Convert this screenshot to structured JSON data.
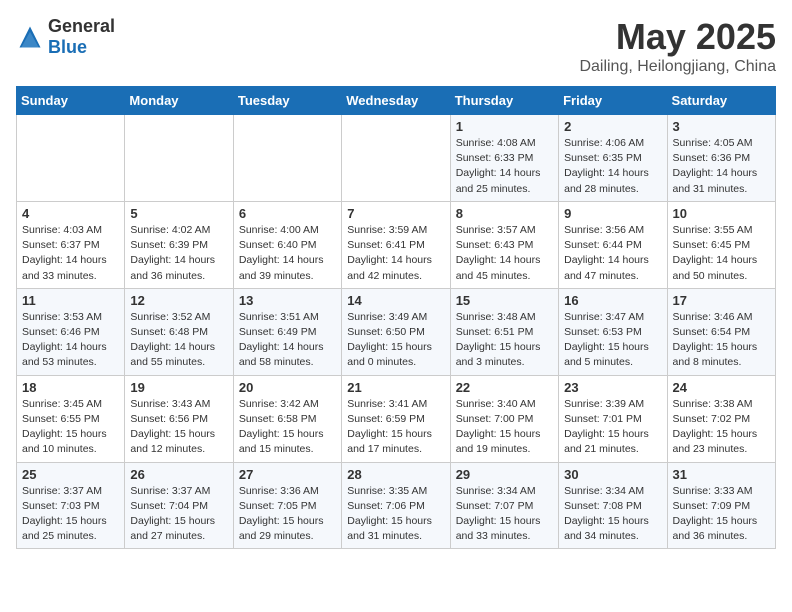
{
  "logo": {
    "general": "General",
    "blue": "Blue"
  },
  "title": "May 2025",
  "subtitle": "Dailing, Heilongjiang, China",
  "days_header": [
    "Sunday",
    "Monday",
    "Tuesday",
    "Wednesday",
    "Thursday",
    "Friday",
    "Saturday"
  ],
  "weeks": [
    [
      {
        "day": "",
        "info": ""
      },
      {
        "day": "",
        "info": ""
      },
      {
        "day": "",
        "info": ""
      },
      {
        "day": "",
        "info": ""
      },
      {
        "day": "1",
        "sunrise": "Sunrise: 4:08 AM",
        "sunset": "Sunset: 6:33 PM",
        "daylight": "Daylight: 14 hours and 25 minutes."
      },
      {
        "day": "2",
        "sunrise": "Sunrise: 4:06 AM",
        "sunset": "Sunset: 6:35 PM",
        "daylight": "Daylight: 14 hours and 28 minutes."
      },
      {
        "day": "3",
        "sunrise": "Sunrise: 4:05 AM",
        "sunset": "Sunset: 6:36 PM",
        "daylight": "Daylight: 14 hours and 31 minutes."
      }
    ],
    [
      {
        "day": "4",
        "sunrise": "Sunrise: 4:03 AM",
        "sunset": "Sunset: 6:37 PM",
        "daylight": "Daylight: 14 hours and 33 minutes."
      },
      {
        "day": "5",
        "sunrise": "Sunrise: 4:02 AM",
        "sunset": "Sunset: 6:39 PM",
        "daylight": "Daylight: 14 hours and 36 minutes."
      },
      {
        "day": "6",
        "sunrise": "Sunrise: 4:00 AM",
        "sunset": "Sunset: 6:40 PM",
        "daylight": "Daylight: 14 hours and 39 minutes."
      },
      {
        "day": "7",
        "sunrise": "Sunrise: 3:59 AM",
        "sunset": "Sunset: 6:41 PM",
        "daylight": "Daylight: 14 hours and 42 minutes."
      },
      {
        "day": "8",
        "sunrise": "Sunrise: 3:57 AM",
        "sunset": "Sunset: 6:43 PM",
        "daylight": "Daylight: 14 hours and 45 minutes."
      },
      {
        "day": "9",
        "sunrise": "Sunrise: 3:56 AM",
        "sunset": "Sunset: 6:44 PM",
        "daylight": "Daylight: 14 hours and 47 minutes."
      },
      {
        "day": "10",
        "sunrise": "Sunrise: 3:55 AM",
        "sunset": "Sunset: 6:45 PM",
        "daylight": "Daylight: 14 hours and 50 minutes."
      }
    ],
    [
      {
        "day": "11",
        "sunrise": "Sunrise: 3:53 AM",
        "sunset": "Sunset: 6:46 PM",
        "daylight": "Daylight: 14 hours and 53 minutes."
      },
      {
        "day": "12",
        "sunrise": "Sunrise: 3:52 AM",
        "sunset": "Sunset: 6:48 PM",
        "daylight": "Daylight: 14 hours and 55 minutes."
      },
      {
        "day": "13",
        "sunrise": "Sunrise: 3:51 AM",
        "sunset": "Sunset: 6:49 PM",
        "daylight": "Daylight: 14 hours and 58 minutes."
      },
      {
        "day": "14",
        "sunrise": "Sunrise: 3:49 AM",
        "sunset": "Sunset: 6:50 PM",
        "daylight": "Daylight: 15 hours and 0 minutes."
      },
      {
        "day": "15",
        "sunrise": "Sunrise: 3:48 AM",
        "sunset": "Sunset: 6:51 PM",
        "daylight": "Daylight: 15 hours and 3 minutes."
      },
      {
        "day": "16",
        "sunrise": "Sunrise: 3:47 AM",
        "sunset": "Sunset: 6:53 PM",
        "daylight": "Daylight: 15 hours and 5 minutes."
      },
      {
        "day": "17",
        "sunrise": "Sunrise: 3:46 AM",
        "sunset": "Sunset: 6:54 PM",
        "daylight": "Daylight: 15 hours and 8 minutes."
      }
    ],
    [
      {
        "day": "18",
        "sunrise": "Sunrise: 3:45 AM",
        "sunset": "Sunset: 6:55 PM",
        "daylight": "Daylight: 15 hours and 10 minutes."
      },
      {
        "day": "19",
        "sunrise": "Sunrise: 3:43 AM",
        "sunset": "Sunset: 6:56 PM",
        "daylight": "Daylight: 15 hours and 12 minutes."
      },
      {
        "day": "20",
        "sunrise": "Sunrise: 3:42 AM",
        "sunset": "Sunset: 6:58 PM",
        "daylight": "Daylight: 15 hours and 15 minutes."
      },
      {
        "day": "21",
        "sunrise": "Sunrise: 3:41 AM",
        "sunset": "Sunset: 6:59 PM",
        "daylight": "Daylight: 15 hours and 17 minutes."
      },
      {
        "day": "22",
        "sunrise": "Sunrise: 3:40 AM",
        "sunset": "Sunset: 7:00 PM",
        "daylight": "Daylight: 15 hours and 19 minutes."
      },
      {
        "day": "23",
        "sunrise": "Sunrise: 3:39 AM",
        "sunset": "Sunset: 7:01 PM",
        "daylight": "Daylight: 15 hours and 21 minutes."
      },
      {
        "day": "24",
        "sunrise": "Sunrise: 3:38 AM",
        "sunset": "Sunset: 7:02 PM",
        "daylight": "Daylight: 15 hours and 23 minutes."
      }
    ],
    [
      {
        "day": "25",
        "sunrise": "Sunrise: 3:37 AM",
        "sunset": "Sunset: 7:03 PM",
        "daylight": "Daylight: 15 hours and 25 minutes."
      },
      {
        "day": "26",
        "sunrise": "Sunrise: 3:37 AM",
        "sunset": "Sunset: 7:04 PM",
        "daylight": "Daylight: 15 hours and 27 minutes."
      },
      {
        "day": "27",
        "sunrise": "Sunrise: 3:36 AM",
        "sunset": "Sunset: 7:05 PM",
        "daylight": "Daylight: 15 hours and 29 minutes."
      },
      {
        "day": "28",
        "sunrise": "Sunrise: 3:35 AM",
        "sunset": "Sunset: 7:06 PM",
        "daylight": "Daylight: 15 hours and 31 minutes."
      },
      {
        "day": "29",
        "sunrise": "Sunrise: 3:34 AM",
        "sunset": "Sunset: 7:07 PM",
        "daylight": "Daylight: 15 hours and 33 minutes."
      },
      {
        "day": "30",
        "sunrise": "Sunrise: 3:34 AM",
        "sunset": "Sunset: 7:08 PM",
        "daylight": "Daylight: 15 hours and 34 minutes."
      },
      {
        "day": "31",
        "sunrise": "Sunrise: 3:33 AM",
        "sunset": "Sunset: 7:09 PM",
        "daylight": "Daylight: 15 hours and 36 minutes."
      }
    ]
  ]
}
